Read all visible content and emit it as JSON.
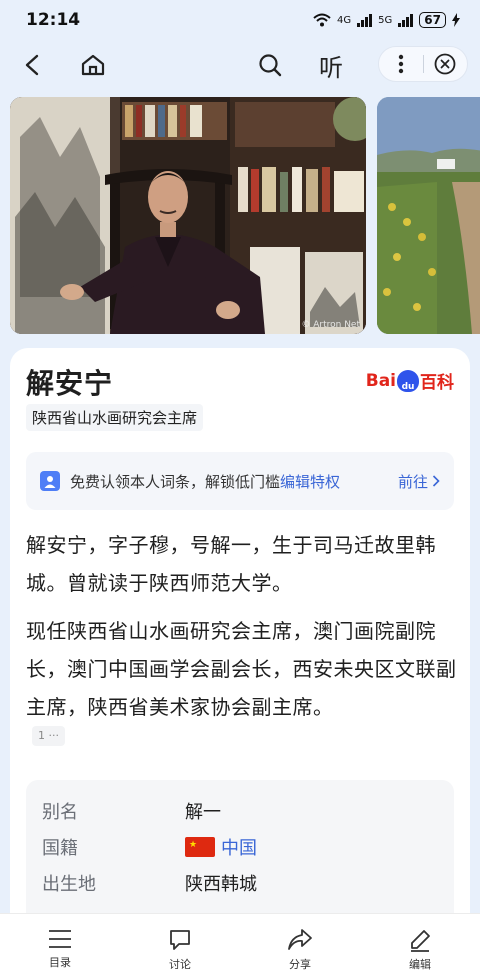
{
  "status": {
    "time": "12:14",
    "net1": "4G",
    "net2": "5G",
    "battery": "67"
  },
  "nav": {
    "listen_label": "听"
  },
  "gallery": {
    "watermark": "© Artron Net"
  },
  "entry": {
    "title": "解安宁",
    "subtitle": "陕西省山水画研究会主席",
    "logo_bai": "Bai",
    "logo_du": "du",
    "logo_baike": "百科"
  },
  "claim": {
    "text": "免费认领本人词条，解锁低门槛",
    "highlight": "编辑特权",
    "action": "前往"
  },
  "paragraphs": [
    "解安宁，字子穆，号解一，生于司马迁故里韩城。曾就读于陕西师范大学。",
    "现任陕西省山水画研究会主席，澳门画院副院长，澳门中国画学会副会长，西安未央区文联副主席，陕西省美术家协会副主席。"
  ],
  "reference": "1 ···",
  "info": [
    {
      "key": "别名",
      "value": "解一"
    },
    {
      "key": "国籍",
      "value": "中国"
    },
    {
      "key": "出生地",
      "value": "陕西韩城"
    }
  ],
  "tabs": [
    {
      "label": "目录",
      "icon": "menu-icon"
    },
    {
      "label": "讨论",
      "icon": "comment-icon"
    },
    {
      "label": "分享",
      "icon": "share-icon"
    },
    {
      "label": "编辑",
      "icon": "edit-icon"
    }
  ],
  "colors": {
    "accent": "#3a66d6",
    "background": "#e8f0fb",
    "brand_red": "#e1251b"
  }
}
